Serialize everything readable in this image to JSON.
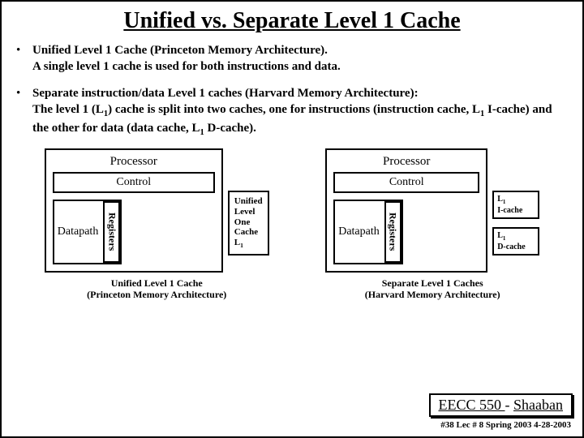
{
  "title": "Unified vs.  Separate Level 1 Cache",
  "bullets": {
    "b1_bold": "Unified Level 1 Cache  (Princeton Memory Architecture).",
    "b1_rest": "A single level 1 cache is used for both instructions and data.",
    "b2_bold": "Separate  instruction/data Level 1 caches (Harvard  Memory Architecture):",
    "b2_rest_a": "The level 1 (L",
    "b2_rest_b": ") cache is split into two caches, one for instructions (instruction cache,  L",
    "b2_rest_c": " I-cache) and the other for data (data cache,  L",
    "b2_rest_d": " D-cache).",
    "sub1": "1"
  },
  "diagram": {
    "processor": "Processor",
    "control": "Control",
    "datapath": "Datapath",
    "registers": "Registers",
    "unified_cache_l1": "Unified",
    "unified_cache_l2": "Level",
    "unified_cache_l3": "One",
    "unified_cache_l4": "Cache",
    "unified_cache_l5a": "L",
    "unified_cache_l5b": "1",
    "icache_a": "L",
    "icache_b": "1",
    "icache_c": "I-cache",
    "dcache_a": "L",
    "dcache_b": "1",
    "dcache_c": "D-cache",
    "caption_left_a": "Unified Level 1 Cache",
    "caption_left_b": "(Princeton Memory Architecture)",
    "caption_right_a": "Separate Level 1 Caches",
    "caption_right_b": "(Harvard  Memory Architecture)"
  },
  "footer": {
    "course": "EECC 550 ",
    "dash": "- ",
    "author": "Shaaban",
    "meta": "#38  Lec # 8   Spring 2003   4-28-2003"
  }
}
